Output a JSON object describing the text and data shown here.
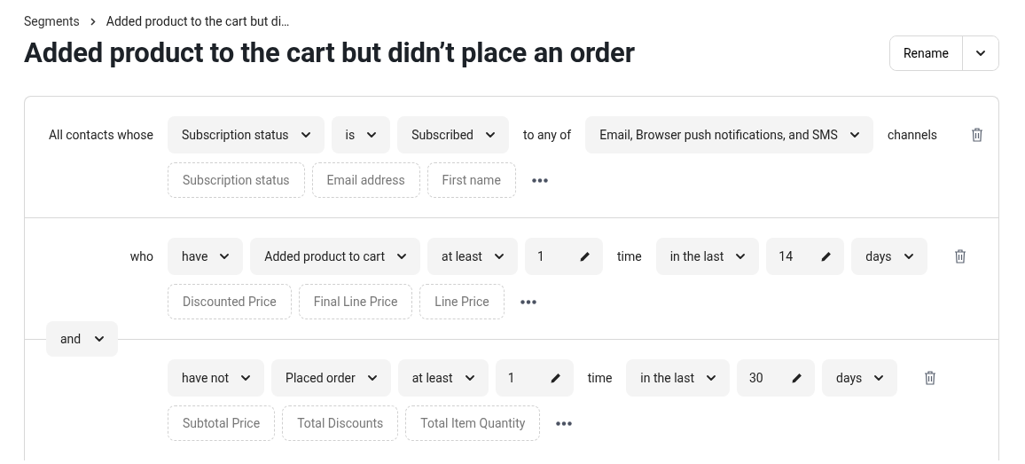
{
  "breadcrumb": {
    "items": [
      {
        "label": "Segments"
      },
      {
        "label": "Added product to the cart but di…"
      }
    ]
  },
  "title": "Added product to the cart but didn’t place an order",
  "actions": {
    "rename": "Rename"
  },
  "conditions": [
    {
      "label": "All contacts whose",
      "controls": [
        {
          "kind": "select",
          "text": "Subscription status"
        },
        {
          "kind": "select",
          "text": "is"
        },
        {
          "kind": "select",
          "text": "Subscribed"
        },
        {
          "kind": "text",
          "text": "to any of"
        },
        {
          "kind": "select",
          "text": "Email, Browser push notifications, and SMS"
        },
        {
          "kind": "text",
          "text": "channels"
        }
      ],
      "chips": [
        "Subscription status",
        "Email address",
        "First name"
      ]
    },
    {
      "label": "who",
      "controls": [
        {
          "kind": "select",
          "text": "have"
        },
        {
          "kind": "select",
          "text": "Added product to cart"
        },
        {
          "kind": "select",
          "text": "at least"
        },
        {
          "kind": "number",
          "text": "1"
        },
        {
          "kind": "text",
          "text": "time"
        },
        {
          "kind": "select",
          "text": "in the last"
        },
        {
          "kind": "number",
          "text": "14"
        },
        {
          "kind": "select",
          "text": "days"
        }
      ],
      "chips": [
        "Discounted Price",
        "Final Line Price",
        "Line Price"
      ]
    },
    {
      "joiner": "and",
      "controls": [
        {
          "kind": "select",
          "text": "have not"
        },
        {
          "kind": "select",
          "text": "Placed order"
        },
        {
          "kind": "select",
          "text": "at least"
        },
        {
          "kind": "number",
          "text": "1"
        },
        {
          "kind": "text",
          "text": "time"
        },
        {
          "kind": "select",
          "text": "in the last"
        },
        {
          "kind": "number",
          "text": "30"
        },
        {
          "kind": "select",
          "text": "days"
        }
      ],
      "chips": [
        "Subtotal Price",
        "Total Discounts",
        "Total Item Quantity"
      ]
    }
  ]
}
